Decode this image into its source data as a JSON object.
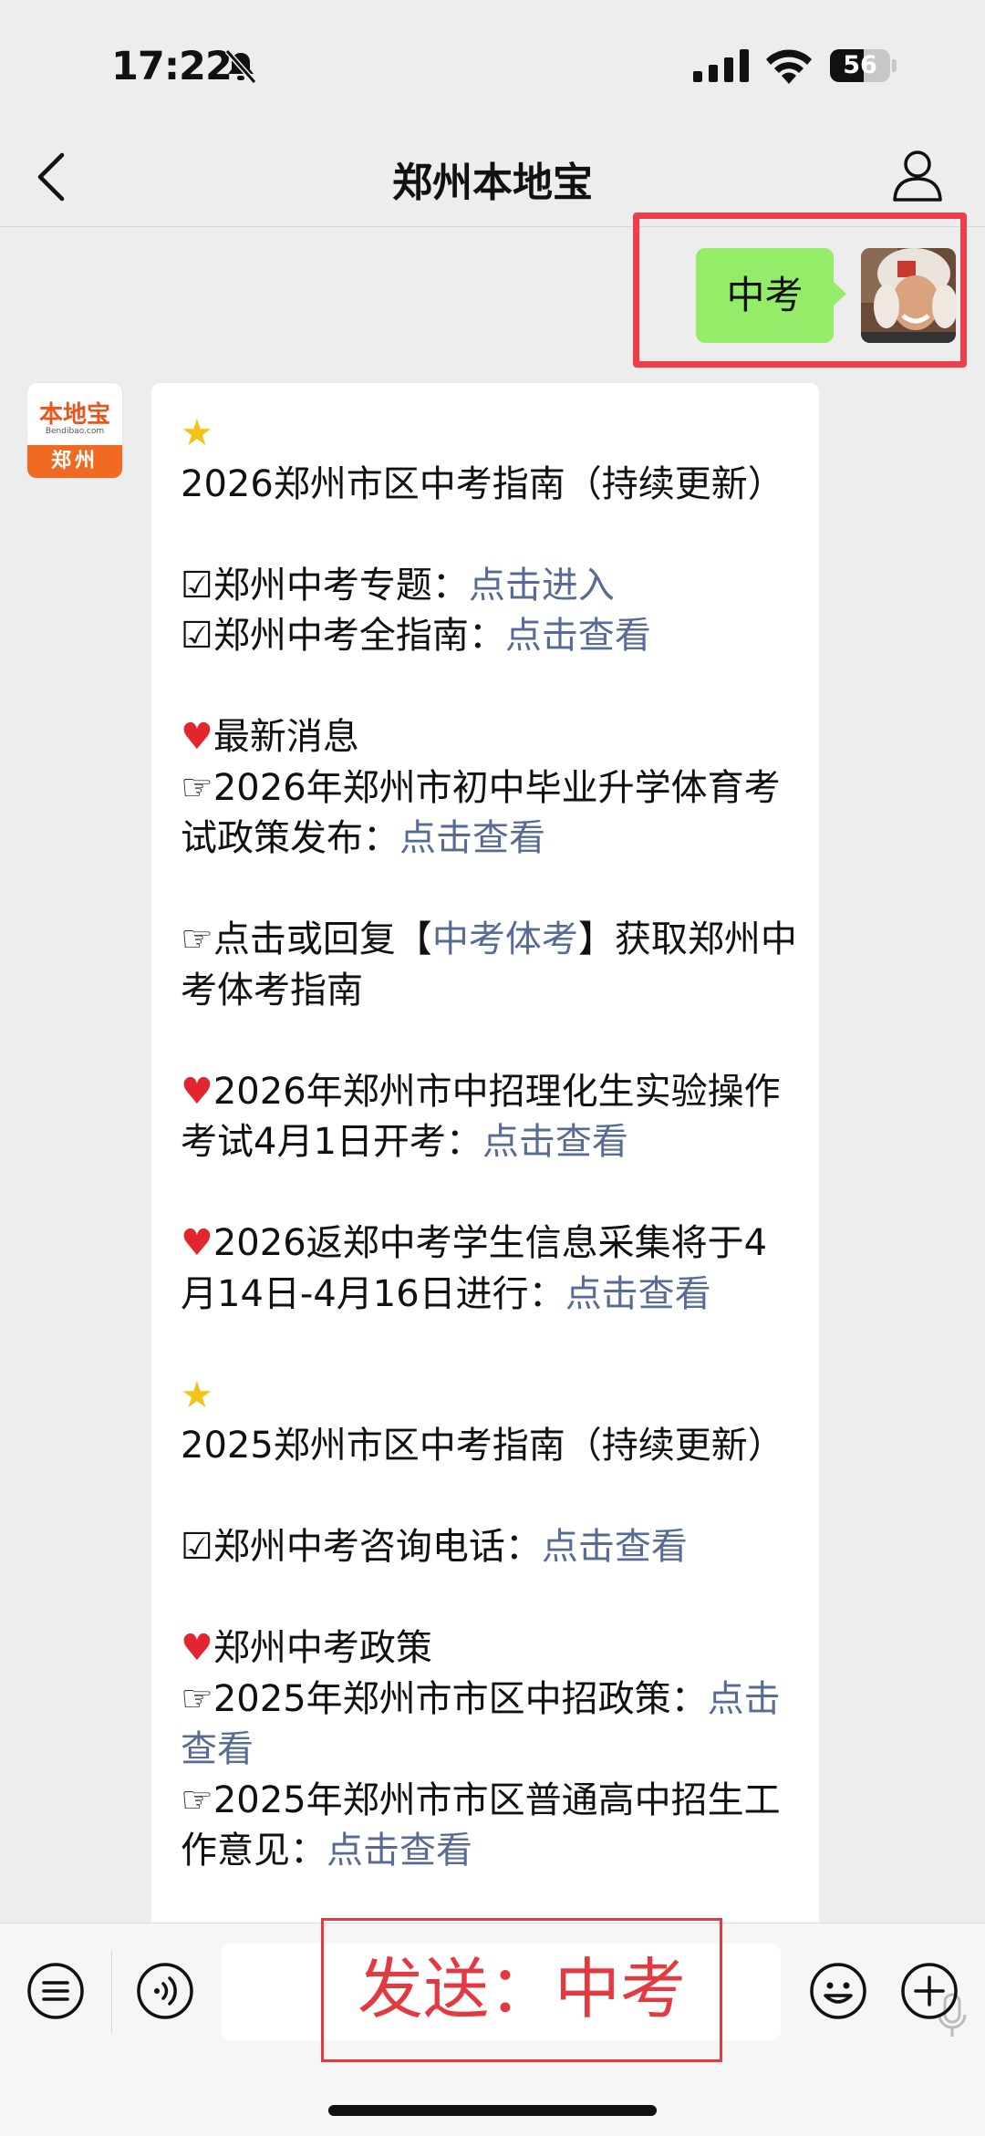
{
  "status_bar": {
    "time": "17:22",
    "battery": "56",
    "battery_level": 0.56
  },
  "nav": {
    "title": "郑州本地宝"
  },
  "sent_message": {
    "text": "中考"
  },
  "bot": {
    "avatar_top": "本地宝",
    "avatar_sub": "Bendibao.com",
    "avatar_city": "郑州"
  },
  "reply": {
    "l1_text": "2026郑州市区中考指南（持续更新）",
    "l2_label": "郑州中考专题：",
    "l2_link": "点击进入",
    "l3_label": "郑州中考全指南：",
    "l3_link": "点击查看",
    "l4_text": "最新消息",
    "l5_label": "2026年郑州市初中毕业升学体育考试政策发布：",
    "l5_link": "点击查看",
    "l6_pre": "点击或回复【",
    "l6_link": "中考体考",
    "l6_post": "】获取郑州中考体考指南",
    "l7_label": "2026年郑州市中招理化生实验操作考试4月1日开考：",
    "l7_link": "点击查看",
    "l8_label": "2026返郑中考学生信息采集将于4月14日-4月16日进行：",
    "l8_link": "点击查看",
    "l9_text": "2025郑州市区中考指南（持续更新）",
    "l10_label": "郑州中考咨询电话：",
    "l10_link": "点击查看",
    "l11_text": "郑州中考政策",
    "l12_label": "2025年郑州市市区中招政策：",
    "l12_link": "点击查看",
    "l13_label": "2025年郑州市市区普通高中招生工作意见：",
    "l13_link": "点击查看",
    "icons": {
      "star": "star-emoji",
      "heart": "heart-emoji",
      "check": "check-box",
      "pointer": "pointing-hand"
    }
  },
  "overlay": {
    "send_text": "发送：中考"
  },
  "colors": {
    "bubble_green": "#95ec69",
    "link": "#576b95",
    "highlight": "#ef3e4a"
  }
}
